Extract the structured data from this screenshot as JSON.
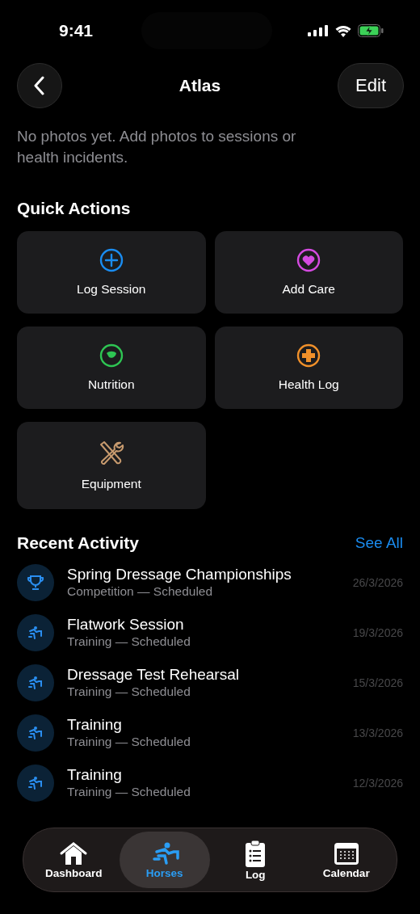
{
  "status_bar": {
    "time": "9:41"
  },
  "nav": {
    "title": "Atlas",
    "edit": "Edit"
  },
  "photos": {
    "empty_text": "No photos yet. Add photos to sessions or health incidents."
  },
  "quick_actions": {
    "title": "Quick Actions",
    "items": [
      {
        "label": "Log Session",
        "kind": "plus",
        "color": "#1a8cf0"
      },
      {
        "label": "Add Care",
        "kind": "heart",
        "color": "#d44ae0"
      },
      {
        "label": "Nutrition",
        "kind": "leaf",
        "color": "#2ec553"
      },
      {
        "label": "Health Log",
        "kind": "cross",
        "color": "#f0902a"
      },
      {
        "label": "Equipment",
        "kind": "tools",
        "color": "#c79a6e"
      }
    ]
  },
  "recent_activity": {
    "title": "Recent Activity",
    "see_all": "See All",
    "items": [
      {
        "title": "Spring Dressage Championships",
        "subtitle": "Competition — Scheduled",
        "date": "26/3/2026",
        "kind": "trophy"
      },
      {
        "title": "Flatwork Session",
        "subtitle": "Training — Scheduled",
        "date": "19/3/2026",
        "kind": "rider"
      },
      {
        "title": "Dressage Test Rehearsal",
        "subtitle": "Training — Scheduled",
        "date": "15/3/2026",
        "kind": "rider"
      },
      {
        "title": "Training",
        "subtitle": "Training — Scheduled",
        "date": "13/3/2026",
        "kind": "rider"
      },
      {
        "title": "Training",
        "subtitle": "Training — Scheduled",
        "date": "12/3/2026",
        "kind": "rider"
      }
    ]
  },
  "tabs": [
    {
      "label": "Dashboard",
      "kind": "home",
      "selected": false
    },
    {
      "label": "Horses",
      "kind": "rider",
      "selected": true
    },
    {
      "label": "Log",
      "kind": "clipboard",
      "selected": false
    },
    {
      "label": "Calendar",
      "kind": "calendar",
      "selected": false
    }
  ]
}
